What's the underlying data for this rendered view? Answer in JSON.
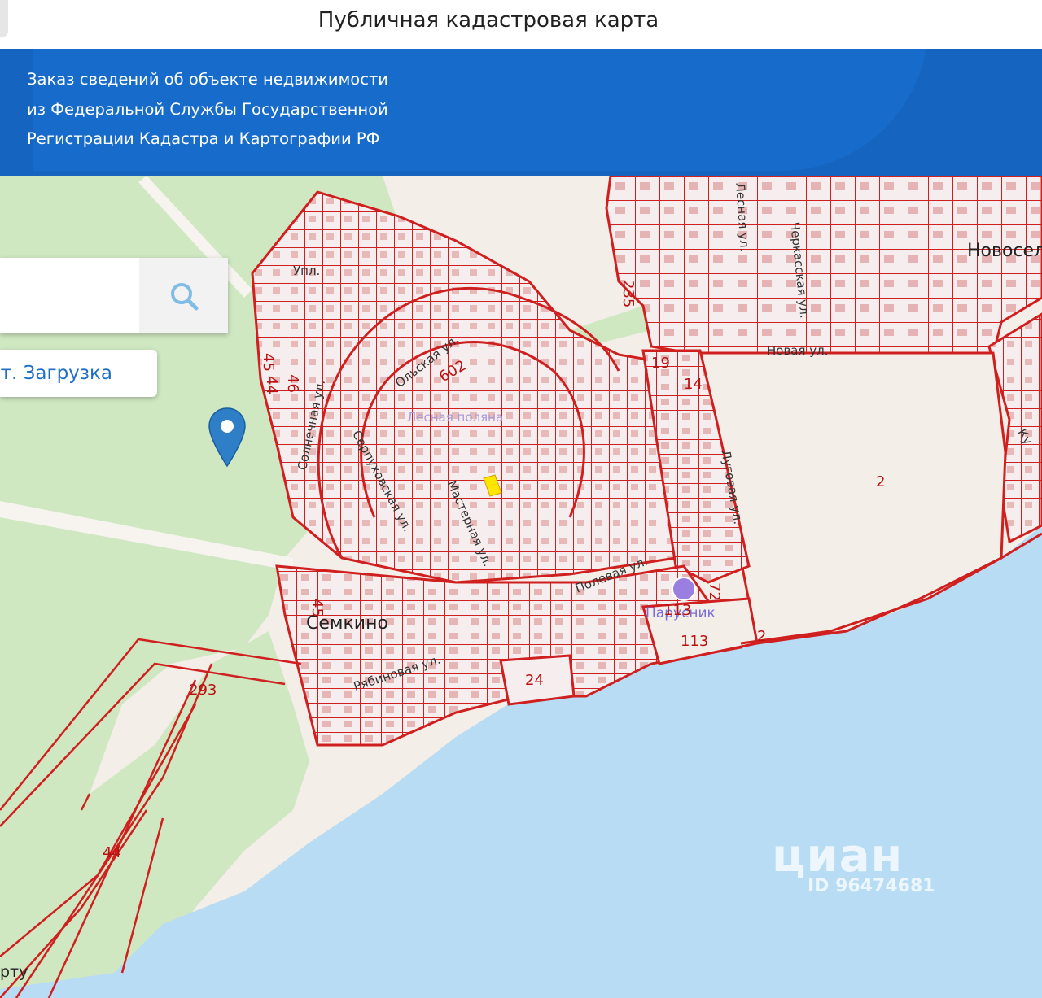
{
  "header": {
    "title": "Публичная кадастровая карта"
  },
  "banner": {
    "lines": [
      "Заказ сведений об объекте недвижимости",
      "из Федеральной Службы Государственной",
      "Регистрации Кадастра и Картографии РФ"
    ]
  },
  "search": {
    "icon": "search-icon"
  },
  "load_button": {
    "label": "ут. Загрузка"
  },
  "map": {
    "colors": {
      "forest": "#cfe8c2",
      "land": "#f3eee8",
      "water": "#b7dcf3",
      "parcel_line": "#d01f1f",
      "highlight": "#ffe600",
      "banner": "#1565c0"
    },
    "places": [
      {
        "name": "Семкино"
      },
      {
        "name": "Новосел"
      },
      {
        "name": "Парусник"
      },
      {
        "name": "Лесная поляна"
      }
    ],
    "streets": [
      "Солнечная ул.",
      "Серпуховская ул.",
      "Мастерная ул.",
      "Полевая ул.",
      "Рябиновая ул.",
      "Новая ул.",
      "Луговая ул.",
      "Черкасская ул.",
      "Лесная ул.",
      "Ольская ул.",
      "Упл.",
      "Ку"
    ],
    "parcel_numbers": [
      "45",
      "44",
      "46",
      "602",
      "235",
      "19",
      "14",
      "2",
      "2",
      "72",
      "113",
      "113",
      "24",
      "45",
      "293",
      "44"
    ],
    "watermark": {
      "brand": "циан",
      "id": "ID 96474681"
    }
  },
  "footer": {
    "link": "рту"
  }
}
